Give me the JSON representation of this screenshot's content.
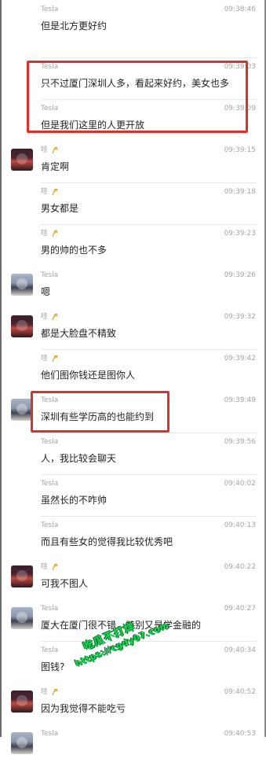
{
  "messages": [
    {
      "sender": "Tesla",
      "time": "09:38:46",
      "text": "但是北方更好约",
      "avatar": "none",
      "sender_icon": "none"
    },
    {
      "sender": "Tesla",
      "time": "09:39:03",
      "text": "只不过厦门深圳人多，看起来好约，美女也多",
      "avatar": "none",
      "sender_icon": "none"
    },
    {
      "sender": "Tesla",
      "time": "09:39:09",
      "text": "但是我们这里的人更开放",
      "avatar": "none",
      "sender_icon": "none"
    },
    {
      "sender": "哇",
      "time": "09:39:15",
      "text": "肯定啊",
      "avatar": "avatar-a",
      "sender_icon": "wheat-icon"
    },
    {
      "sender": "哇",
      "time": "09:39:18",
      "text": "男女都是",
      "avatar": "none",
      "sender_icon": "wheat-icon"
    },
    {
      "sender": "哇",
      "time": "09:39:23",
      "text": "男的帅的也不多",
      "avatar": "none",
      "sender_icon": "wheat-icon"
    },
    {
      "sender": "Tesla",
      "time": "09:39:26",
      "text": "嗯",
      "avatar": "avatar-b",
      "sender_icon": "none"
    },
    {
      "sender": "哇",
      "time": "09:39:32",
      "text": "都是大脸盘不精致",
      "avatar": "avatar-a",
      "sender_icon": "wheat-icon"
    },
    {
      "sender": "哇",
      "time": "09:39:42",
      "text": "他们图你钱还是图你人",
      "avatar": "none",
      "sender_icon": "wheat-icon"
    },
    {
      "sender": "Tesla",
      "time": "09:39:49",
      "text": "深圳有些学历高的也能约到",
      "avatar": "avatar-b",
      "sender_icon": "none"
    },
    {
      "sender": "Tesla",
      "time": "09:39:56",
      "text": "人，我比较会聊天",
      "avatar": "none",
      "sender_icon": "none"
    },
    {
      "sender": "Tesla",
      "time": "09:40:02",
      "text": "虽然长的不咋帅",
      "avatar": "none",
      "sender_icon": "none"
    },
    {
      "sender": "Tesla",
      "time": "09:40:13",
      "text": "而且有些女的觉得我比较优秀吧",
      "avatar": "none",
      "sender_icon": "none"
    },
    {
      "sender": "哇",
      "time": "09:40:22",
      "text": "可我不图人",
      "avatar": "avatar-a",
      "sender_icon": "wheat-icon"
    },
    {
      "sender": "Tesla",
      "time": "09:40:27",
      "text": "厦大在厦门很不错，特别又是学金融的",
      "avatar": "avatar-b",
      "sender_icon": "none"
    },
    {
      "sender": "Tesla",
      "time": "09:40:34",
      "text": "图钱?",
      "avatar": "none",
      "sender_icon": "none"
    },
    {
      "sender": "哇",
      "time": "09:40:52",
      "text": "因为我觉得不能吃亏",
      "avatar": "avatar-a",
      "sender_icon": "wheat-icon"
    },
    {
      "sender": "Tesla",
      "time": "09:40:53",
      "text": "",
      "avatar": "avatar-b",
      "sender_icon": "none"
    }
  ],
  "watermark": {
    "line1": "吃瓜不打烊",
    "line2": "https://cgdy07.com"
  },
  "colors": {
    "highlight": "#d9312b",
    "watermark": "#12e04f",
    "text": "#1f1f1f",
    "meta": "#a4a4a4"
  }
}
